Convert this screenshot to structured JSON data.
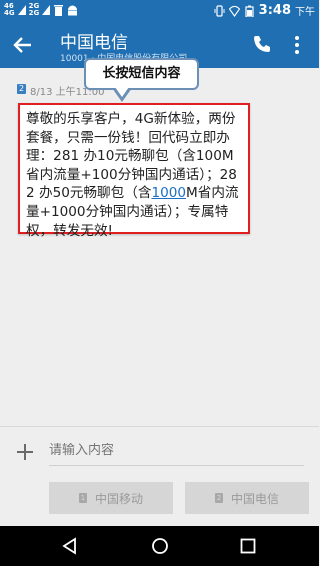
{
  "status_bar": {
    "signal1": "4G",
    "signal2": "2G",
    "net1": "46",
    "time": "3:48",
    "ampm": "下午",
    "icons": [
      "signal-icon",
      "signal-icon",
      "trash-icon",
      "android-icon",
      "vibrate-icon",
      "wifi-off-icon",
      "battery-icon"
    ]
  },
  "app_bar": {
    "title": "中国电信",
    "subtitle": "10001 · 中国电信股份有限公司"
  },
  "message": {
    "sim": "2",
    "meta": "8/13 上午11:00",
    "text_before": "尊敬的乐享客户，4G新体验，两份套餐，只需一份钱！回代码立即办理：281 办10元畅聊包（含100M省内流量+100分钟国内通话）；282 办50元畅聊包（含",
    "link_text": "1000",
    "text_after": "M省内流量+1000分钟国内通话）；专属特权，转发无效!"
  },
  "tooltip": {
    "text": "长按短信内容"
  },
  "compose": {
    "placeholder": "请输入内容",
    "send_sim1": "中国移动",
    "send_sim1_badge": "1",
    "send_sim2": "中国电信",
    "send_sim2_badge": "2"
  },
  "colors": {
    "primary": "#1f6fb2",
    "highlight_border": "#e02020",
    "link": "#1e6fc4"
  }
}
